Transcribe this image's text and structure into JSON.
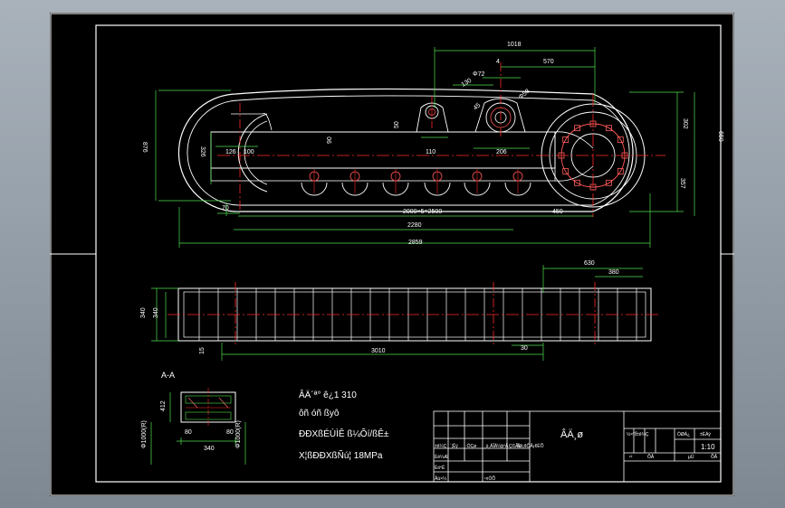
{
  "colors": {
    "background": "#000000",
    "viewport_gray": "#8e97a1",
    "outline": "#ffffff",
    "dimension": "#4fe04f",
    "centerline": "#ff2a2a",
    "hidden_line": "#ff7070",
    "text_yellow": "#ffff66"
  },
  "dimensions": {
    "d1018": "1018",
    "d570": "570",
    "d4": "4",
    "d72": "Φ72",
    "d130": "130",
    "d45": "45",
    "d90": "90",
    "d50": "50",
    "d58": "Φ58",
    "d110": "110",
    "d206": "206",
    "d302": "302",
    "d650": "650",
    "d357": "357",
    "d876": "876",
    "d326": "326",
    "d126": "126",
    "d100": "100",
    "d70": "70",
    "d2x5": "2000×5=2500",
    "d450": "450",
    "d2280": "2280",
    "d2859": "2859",
    "d630": "630",
    "d380": "380",
    "d340a": "340",
    "d340b": "340",
    "d15": "15",
    "d3010": "3010",
    "d30": "30",
    "s_w1": "412",
    "s_80a": "80",
    "s_80b": "80",
    "s_340": "340",
    "s_l1": "Φ1000(R)",
    "s_l2": "Φ1000(R)"
  },
  "section_label": "A-A",
  "notes": [
    "ÂÄ´ª° ê¿1  310",
    "ôñ   óñ ßyô",
    "ÐÐXßÉÙÌÊ  ß¼Õí/ßÊ±",
    "X¦ßÐÐXßÑú¦  18MPa"
  ],
  "title_block": {
    "title": "ÂÄ¸ø",
    "scale": "1:10",
    "row_labels": [
      "±ê¼Ç",
      "´¦Êý",
      "·ÖÇø",
      "¸ü¸ÄÎÄ¼þºÅ",
      "Ç©Ãû",
      "Äê¡¢ÔÂ¡¢ÈÕ"
    ],
    "designer": "Éè¼Æ",
    "audit": "ÉóºË",
    "process": "¹¤ÒÕ",
    "approve": "Åú×¼",
    "stage": "½×¶Î±ê¼Ç",
    "weight": "ÖØÁ¿",
    "ratio": "±ÈÀý",
    "sheets_a": "¹²",
    "sheets_b": "ÕÅ",
    "sheets_c": "µÚ",
    "sheets_d": "ÕÅ"
  }
}
